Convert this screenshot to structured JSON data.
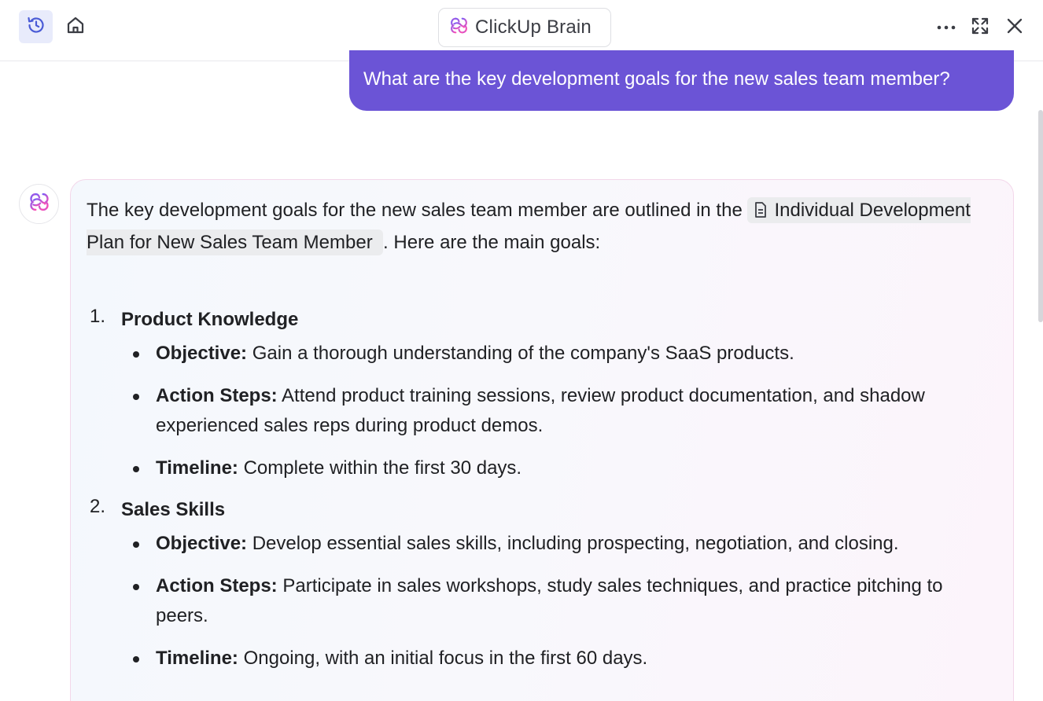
{
  "header": {
    "title": "ClickUp Brain",
    "icons": {
      "history": "history-icon",
      "home": "home-icon",
      "brain_logo": "brain-logo-icon",
      "more": "more-horizontal-icon",
      "expand": "expand-icon",
      "close": "close-icon"
    }
  },
  "colors": {
    "accent_purple": "#6b54d6",
    "history_active_bg": "#e8ebfb",
    "brain_gradient_start": "#7b5cf5",
    "brain_gradient_end": "#ff4fb2"
  },
  "user_message": {
    "text": "What are the key development goals for the new sales team member?"
  },
  "ai_message": {
    "intro": "The key development goals for the new sales team member are outlined in the",
    "doc_link": "Individual Development Plan for New Sales Team Member",
    "intro_tail": ". Here are the main goals:",
    "goals": [
      {
        "num": "1.",
        "title": "Product Knowledge",
        "items": [
          {
            "label": "Objective:",
            "text": "Gain a thorough understanding of the company's SaaS products."
          },
          {
            "label": "Action Steps:",
            "text": "Attend product training sessions, review product documentation, and shadow experienced sales reps during product demos."
          },
          {
            "label": "Timeline:",
            "text": "Complete within the first 30 days."
          }
        ]
      },
      {
        "num": "2.",
        "title": "Sales Skills",
        "items": [
          {
            "label": "Objective:",
            "text": "Develop essential sales skills, including prospecting, negotiation, and closing."
          },
          {
            "label": "Action Steps:",
            "text": "Participate in sales workshops, study sales techniques, and practice pitching to peers."
          },
          {
            "label": "Timeline:",
            "text": "Ongoing, with an initial focus in the first 60 days."
          }
        ]
      }
    ]
  }
}
